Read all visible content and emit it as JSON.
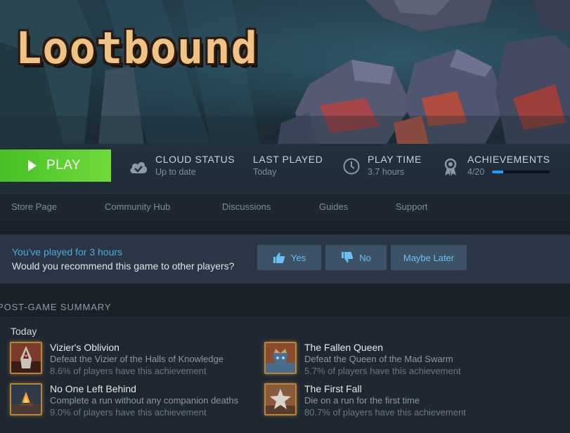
{
  "game": {
    "title": "Lootbound"
  },
  "play": {
    "label": "PLAY"
  },
  "stats": {
    "cloud": {
      "title": "CLOUD STATUS",
      "value": "Up to date",
      "icon": "cloud-check-icon"
    },
    "last_played": {
      "title": "LAST PLAYED",
      "value": "Today"
    },
    "play_time": {
      "title": "PLAY TIME",
      "value": "3.7 hours",
      "icon": "clock-icon"
    },
    "achievements": {
      "title": "ACHIEVEMENTS",
      "value": "4/20",
      "progress": 0.2,
      "icon": "award-icon"
    }
  },
  "nav": {
    "items": [
      "Store Page",
      "Community Hub",
      "Discussions",
      "Guides",
      "Support"
    ]
  },
  "recommend": {
    "hours_text": "You've played for 3 hours",
    "question": "Would you recommend this game to other players?",
    "yes_label": "Yes",
    "no_label": "No",
    "later_label": "Maybe Later"
  },
  "summary": {
    "heading": "POST-GAME SUMMARY",
    "day": "Today",
    "achievements": [
      {
        "name": "Vizier's Oblivion",
        "desc": "Defeat the Vizier of the Halls of Knowledge",
        "pct": "8.6% of players have this achievement",
        "icon": "vizier-achievement-icon"
      },
      {
        "name": "The Fallen Queen",
        "desc": "Defeat the Queen of the Mad Swarm",
        "pct": "5.7% of players have this achievement",
        "icon": "queen-achievement-icon"
      },
      {
        "name": "No One Left Behind",
        "desc": "Complete a run without any companion deaths",
        "pct": "9.0% of players have this achievement",
        "icon": "campfire-achievement-icon"
      },
      {
        "name": "The First Fall",
        "desc": "Die on a run for the first time",
        "pct": "80.7% of players have this achievement",
        "icon": "star-achievement-icon"
      }
    ]
  },
  "colors": {
    "play_green": "#5fd132",
    "link_blue": "#67c1f5",
    "progress_blue": "#1a9fff",
    "badge_gold": "#b8863b"
  }
}
